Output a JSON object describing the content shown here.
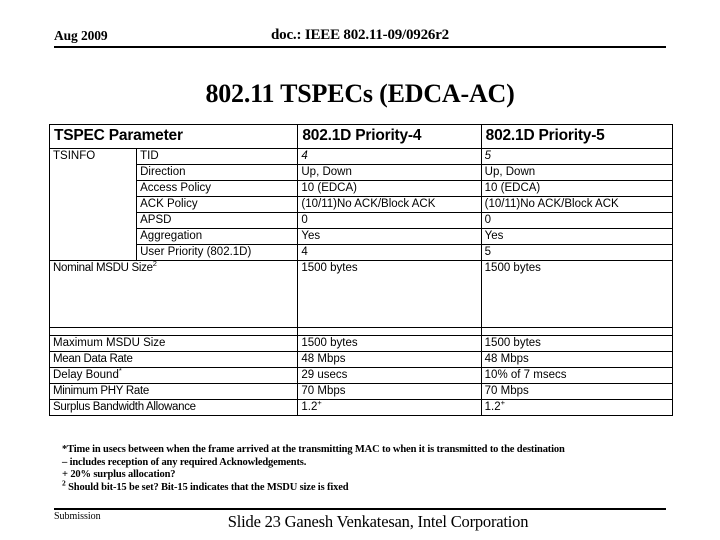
{
  "header": {
    "date": "Aug 2009",
    "doc": "doc.: IEEE 802.11-09/0926r2"
  },
  "title": "802.11 TSPECs (EDCA-AC)",
  "table": {
    "columns": [
      "TSPEC Parameter",
      "802.1D Priority-4",
      "802.1D Priority-5"
    ],
    "group_label": "TSINFO",
    "tsinfo_rows": [
      {
        "label": "TID",
        "p4": "4",
        "p5": "5",
        "italic": true
      },
      {
        "label": "Direction",
        "p4": "Up, Down",
        "p5": "Up, Down",
        "italic": false
      },
      {
        "label": "Access Policy",
        "p4": "10 (EDCA)",
        "p5": "10 (EDCA)",
        "italic": false
      },
      {
        "label": "ACK Policy",
        "p4": "(10/11)No ACK/Block ACK",
        "p5": "(10/11)No ACK/Block ACK",
        "italic": false
      },
      {
        "label": "APSD",
        "p4": "0",
        "p5": "0",
        "italic": false
      },
      {
        "label": "Aggregation",
        "p4": "Yes",
        "p5": "Yes",
        "italic": false
      },
      {
        "label": "User Priority (802.1D)",
        "p4": "4",
        "p5": "5",
        "italic": false
      }
    ],
    "nominal_row": {
      "label": "Nominal MSDU Size",
      "label_sup": "2",
      "p4": "1500 bytes",
      "p5": "1500 bytes"
    },
    "bottom_rows": [
      {
        "label": "Maximum MSDU Size",
        "p4": "1500 bytes",
        "p5": "1500 bytes",
        "bold": false,
        "sup": ""
      },
      {
        "label": "Mean Data Rate",
        "p4": "48 Mbps",
        "p5": "48 Mbps",
        "bold": true,
        "sup": ""
      },
      {
        "label": "Delay Bound",
        "p4": "29 usecs",
        "p5": "10% of 7 msecs",
        "bold": false,
        "sup": "*"
      },
      {
        "label": "Minimum PHY Rate",
        "p4": "70 Mbps",
        "p5": "70 Mbps",
        "bold": true,
        "sup": ""
      },
      {
        "label": "Surplus Bandwidth Allowance",
        "p4": "1.2",
        "p5": "1.2",
        "bold": true,
        "sup": "",
        "value_sup": "+"
      }
    ]
  },
  "footnotes": [
    {
      "marker": "*",
      "sup": false,
      "text": "Time in usecs between when the frame arrived at the transmitting MAC to when it is transmitted to the destination"
    },
    {
      "marker": "–",
      "sup": false,
      "text": " includes reception of  any required Acknowledgements."
    },
    {
      "marker": "+",
      "sup": false,
      "text": " 20% surplus allocation?"
    },
    {
      "marker": "2",
      "sup": true,
      "text": " Should bit-15 be set? Bit-15 indicates that the MSDU size is fixed"
    }
  ],
  "footer": {
    "submission": "Submission",
    "slide_info": "Slide 23 Ganesh Venkatesan, Intel Corporation"
  }
}
